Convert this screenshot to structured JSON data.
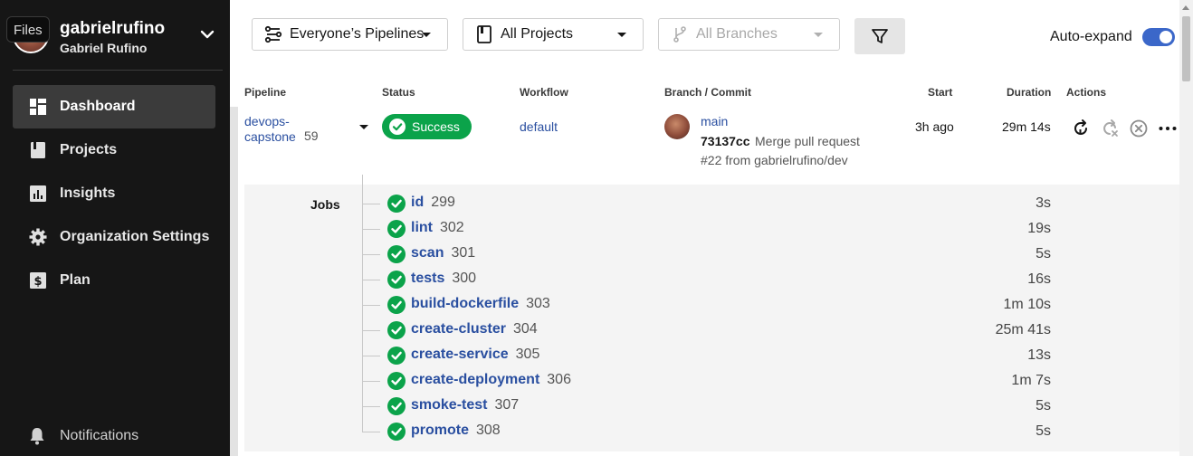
{
  "overlay": {
    "files_badge": "Files"
  },
  "org": {
    "name": "gabrielrufino",
    "user": "Gabriel Rufino"
  },
  "sidebar": {
    "items": [
      {
        "label": "Dashboard",
        "icon": "dashboard-icon",
        "active": true
      },
      {
        "label": "Projects",
        "icon": "projects-icon",
        "active": false
      },
      {
        "label": "Insights",
        "icon": "insights-icon",
        "active": false
      },
      {
        "label": "Organization Settings",
        "icon": "gear-icon",
        "active": false
      },
      {
        "label": "Plan",
        "icon": "dollar-icon",
        "active": false
      }
    ],
    "notifications_label": "Notifications"
  },
  "toolbar": {
    "pipelines_filter": "Everyone’s Pipelines",
    "projects_filter": "All Projects",
    "branches_filter": "All Branches",
    "auto_expand_label": "Auto-expand",
    "auto_expand_on": true
  },
  "table": {
    "headers": {
      "pipeline": "Pipeline",
      "status": "Status",
      "workflow": "Workflow",
      "branch_commit": "Branch / Commit",
      "start": "Start",
      "duration": "Duration",
      "actions": "Actions"
    }
  },
  "pipeline": {
    "name": "devops-capstone",
    "number": "59",
    "status": "Success",
    "workflow": "default",
    "branch": "main",
    "commit_hash": "73137cc",
    "commit_message_line1": "Merge pull request",
    "commit_message_line2": "#22 from gabrielrufino/dev",
    "start": "3h ago",
    "duration": "29m 14s"
  },
  "jobs": {
    "label": "Jobs",
    "items": [
      {
        "name": "id",
        "number": "299",
        "duration": "3s"
      },
      {
        "name": "lint",
        "number": "302",
        "duration": "19s"
      },
      {
        "name": "scan",
        "number": "301",
        "duration": "5s"
      },
      {
        "name": "tests",
        "number": "300",
        "duration": "16s"
      },
      {
        "name": "build-dockerfile",
        "number": "303",
        "duration": "1m 10s"
      },
      {
        "name": "create-cluster",
        "number": "304",
        "duration": "25m 41s"
      },
      {
        "name": "create-service",
        "number": "305",
        "duration": "13s"
      },
      {
        "name": "create-deployment",
        "number": "306",
        "duration": "1m 7s"
      },
      {
        "name": "smoke-test",
        "number": "307",
        "duration": "5s"
      },
      {
        "name": "promote",
        "number": "308",
        "duration": "5s"
      }
    ]
  },
  "colors": {
    "success": "#0ba34a",
    "link": "#2a4fa0",
    "sidebar_bg": "#161616",
    "toggle_on": "#3b67c9"
  }
}
